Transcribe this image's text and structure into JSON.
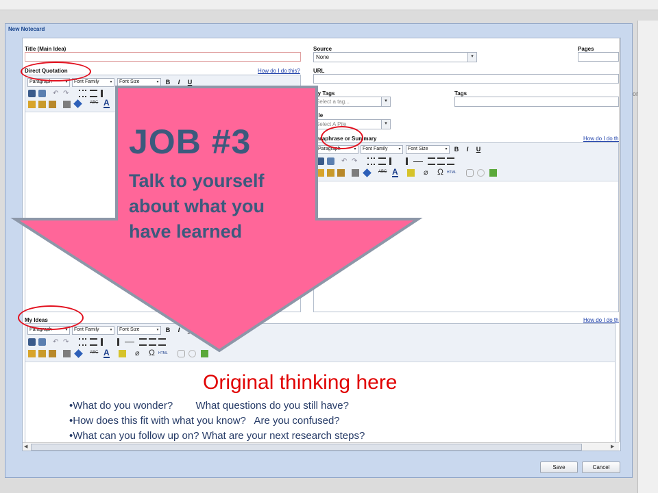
{
  "dialog": {
    "title": "New Notecard"
  },
  "left": {
    "title_label": "Title (Main Idea)",
    "quote_label": "Direct Quotation",
    "quote_help": "How do I do this?",
    "ideas_label": "My Ideas",
    "ideas_help": "How do I do this?"
  },
  "right": {
    "source_label": "Source",
    "source_value": "None",
    "pages_label": "Pages",
    "url_label": "URL",
    "mytags_label": "My Tags",
    "mytags_placeholder": "Select a tag...",
    "tags_label": "Tags",
    "pile_label": "Pile",
    "pile_placeholder": "Select A Pile",
    "para_label": "Paraphrase or Summary",
    "para_help": "How do I do this?"
  },
  "toolbar": {
    "paragraph": "Paragraph",
    "font_family": "Font Family",
    "font_size": "Font Size",
    "bold": "B",
    "italic": "I",
    "underline": "U"
  },
  "buttons": {
    "save": "Save",
    "cancel": "Cancel"
  },
  "overlay": {
    "job_title": "JOB #3",
    "job_line1": "Talk to yourself",
    "job_line2": "about what you",
    "job_line3": "have learned",
    "arrow_color": "#ff6699",
    "circle_color": "#e2101e"
  },
  "notes": {
    "heading": "Original  thinking  here",
    "bullet1": "•What do you wonder?        What questions do you still have?",
    "bullet2": "•How does this fit with what you know?   Are you confused?",
    "bullet3": "•What can you follow up on? What are your next research steps?"
  },
  "background": {
    "side_text": "or"
  }
}
